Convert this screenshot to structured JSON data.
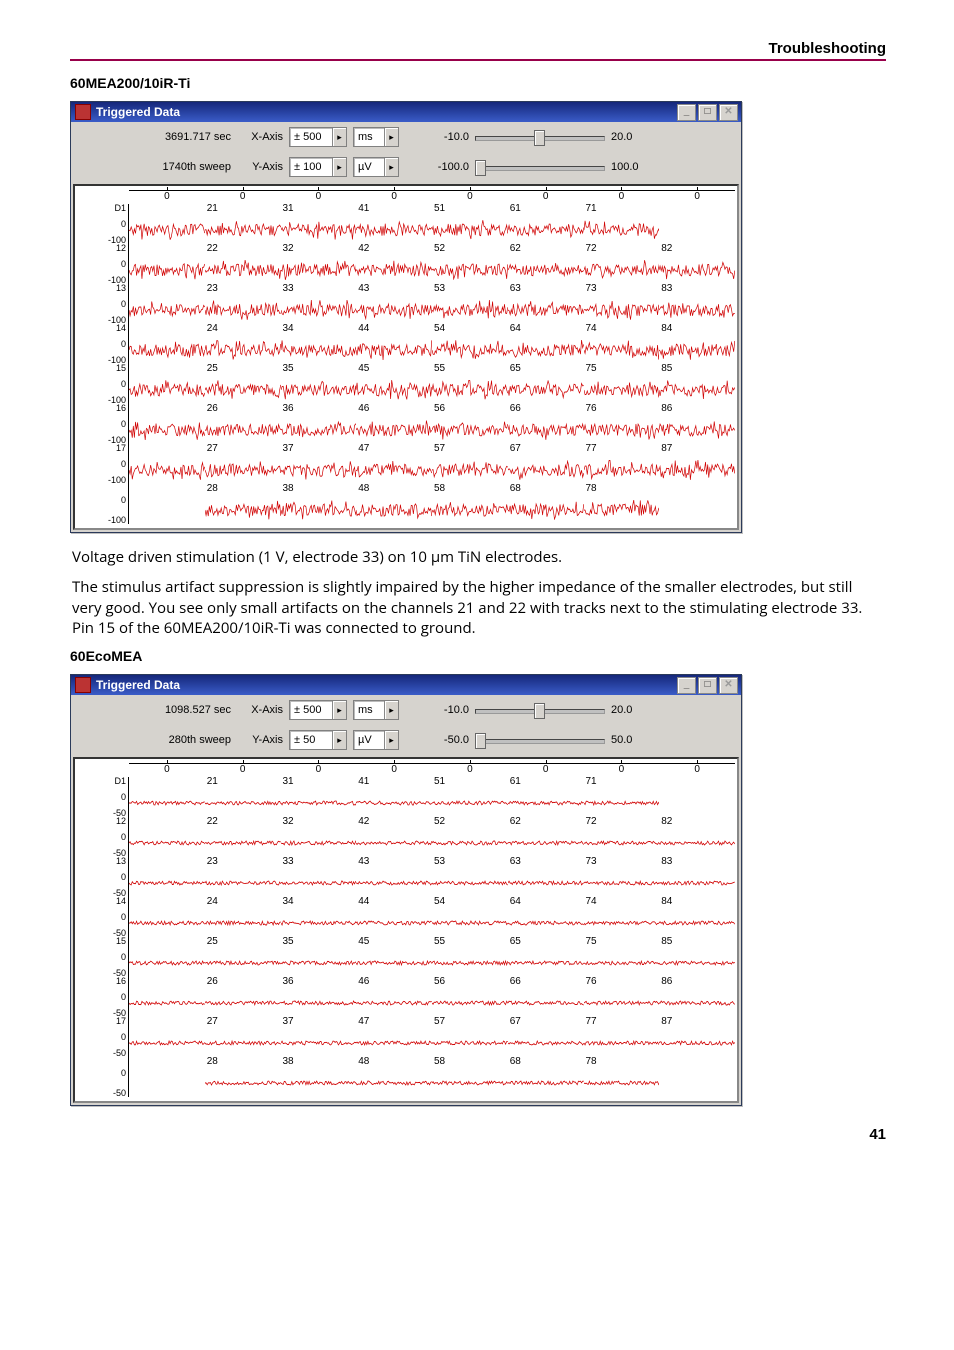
{
  "header": {
    "section": "Troubleshooting"
  },
  "footer": {
    "page": "41"
  },
  "h1": "60MEA200/10iR-Ti",
  "p1": "Voltage driven stimulation (1 V, electrode 33) on 10 µm TiN electrodes.",
  "p2": "The stimulus artifact suppression is slightly impaired by the higher impedance of the smaller electrodes, but still very good. You see only small artifacts on the channels 21 and 22 with tracks next to the stimulating electrode 33. Pin 15 of the 60MEA200/10iR-Ti was connected to ground.",
  "h2": "60EcoMEA",
  "fig1": {
    "title": "Triggered Data",
    "info1": "3691.717 sec",
    "info2": "1740th sweep",
    "xlabel": "X-Axis",
    "ylabel": "Y-Axis",
    "xval": "± 500",
    "xunit": "ms",
    "yval": "± 100",
    "yunit": "µV",
    "sl1a": "-10.0",
    "sl1b": "20.0",
    "sl2a": "-100.0",
    "sl2b": "100.0",
    "ytick_hi": "0",
    "ytick_lo": "-100",
    "ytick_mid": "0",
    "col0": "0",
    "rows": [
      [
        "D1",
        "21",
        "31",
        "41",
        "51",
        "61",
        "71",
        ""
      ],
      [
        "12",
        "22",
        "32",
        "42",
        "52",
        "62",
        "72",
        "82"
      ],
      [
        "13",
        "23",
        "33",
        "43",
        "53",
        "63",
        "73",
        "83"
      ],
      [
        "14",
        "24",
        "34",
        "44",
        "54",
        "64",
        "74",
        "84"
      ],
      [
        "15",
        "25",
        "35",
        "45",
        "55",
        "65",
        "75",
        "85"
      ],
      [
        "16",
        "26",
        "36",
        "46",
        "56",
        "66",
        "76",
        "86"
      ],
      [
        "17",
        "27",
        "37",
        "47",
        "57",
        "67",
        "77",
        "87"
      ],
      [
        "",
        "28",
        "38",
        "48",
        "58",
        "68",
        "78",
        ""
      ]
    ],
    "thumb1": "45%",
    "thumb2": "0%"
  },
  "fig2": {
    "title": "Triggered Data",
    "info1": "1098.527 sec",
    "info2": "280th sweep",
    "xlabel": "X-Axis",
    "ylabel": "Y-Axis",
    "xval": "± 500",
    "xunit": "ms",
    "yval": "± 50",
    "yunit": "µV",
    "sl1a": "-10.0",
    "sl1b": "20.0",
    "sl2a": "-50.0",
    "sl2b": "50.0",
    "ytick_hi": "0",
    "ytick_lo": "-50",
    "ytick_mid": "0",
    "col0": "0",
    "rows": [
      [
        "D1",
        "21",
        "31",
        "41",
        "51",
        "61",
        "71",
        ""
      ],
      [
        "12",
        "22",
        "32",
        "42",
        "52",
        "62",
        "72",
        "82"
      ],
      [
        "13",
        "23",
        "33",
        "43",
        "53",
        "63",
        "73",
        "83"
      ],
      [
        "14",
        "24",
        "34",
        "44",
        "54",
        "64",
        "74",
        "84"
      ],
      [
        "15",
        "25",
        "35",
        "45",
        "55",
        "65",
        "75",
        "85"
      ],
      [
        "16",
        "26",
        "36",
        "46",
        "56",
        "66",
        "76",
        "86"
      ],
      [
        "17",
        "27",
        "37",
        "47",
        "57",
        "67",
        "77",
        "87"
      ],
      [
        "",
        "28",
        "38",
        "48",
        "58",
        "68",
        "78",
        ""
      ]
    ],
    "thumb1": "45%",
    "thumb2": "0%"
  }
}
